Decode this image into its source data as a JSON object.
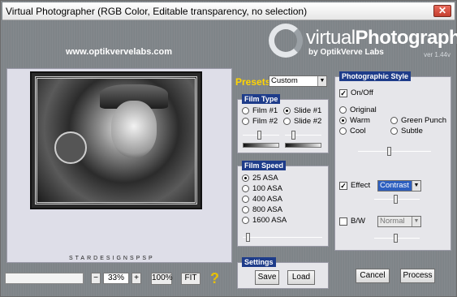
{
  "window": {
    "title": "Virtual Photographer (RGB Color, Editable transparency, no selection)",
    "close_label": "✕"
  },
  "logo": {
    "main_plain": "virtual",
    "main_bold": "Photographer",
    "sub": "by OptikVerve Labs",
    "version": "ver 1.44v"
  },
  "url": "www.optikvervelabs.com",
  "preview": {
    "caption": "STARDESIGNSPSP"
  },
  "zoom": {
    "minus": "−",
    "value": "33%",
    "plus": "+",
    "full": "100%",
    "fit": "FIT",
    "help": "?"
  },
  "presets": {
    "label": "Presets",
    "selected": "Custom"
  },
  "film_type": {
    "label": "Film Type",
    "options": [
      "Film #1",
      "Slide #1",
      "Film #2",
      "Slide #2"
    ],
    "selected": "Slide #1"
  },
  "film_speed": {
    "label": "Film Speed",
    "options": [
      "25 ASA",
      "100 ASA",
      "400 ASA",
      "800 ASA",
      "1600 ASA"
    ],
    "selected": "25 ASA"
  },
  "settings": {
    "label": "Settings",
    "save": "Save",
    "load": "Load"
  },
  "photographic_style": {
    "label": "Photographic Style",
    "onoff": "On/Off",
    "onoff_checked": true,
    "styles": [
      "Original",
      "Warm",
      "Green Punch",
      "Cool",
      "Subtle"
    ],
    "selected": "Warm",
    "effect_label": "Effect",
    "effect_checked": true,
    "effect_value": "Contrast",
    "bw_label": "B/W",
    "bw_checked": false,
    "bw_value": "Normal"
  },
  "actions": {
    "cancel": "Cancel",
    "process": "Process"
  }
}
